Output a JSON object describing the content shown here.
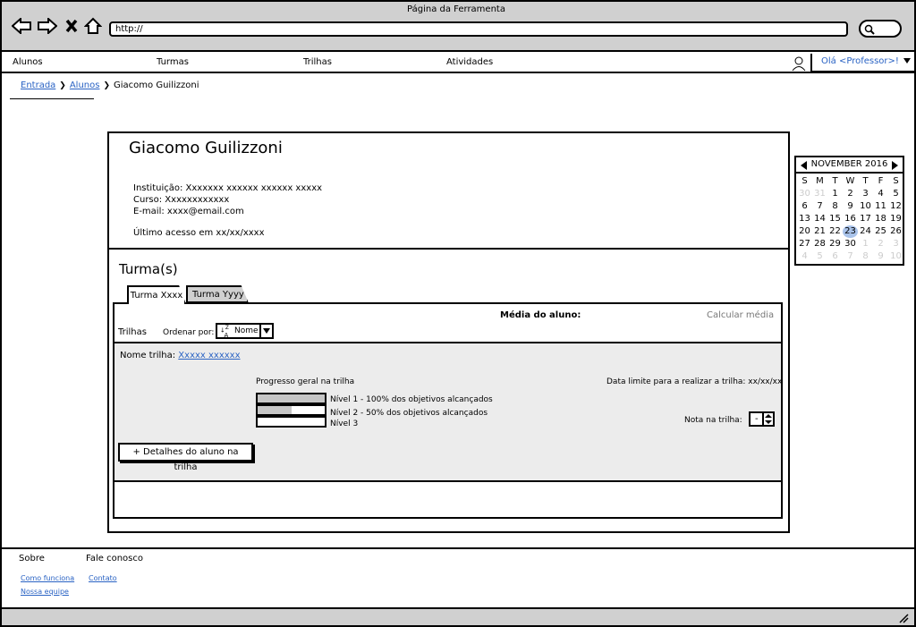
{
  "browser": {
    "title": "Página da Ferramenta",
    "url": "http://"
  },
  "menu": {
    "items": [
      "Alunos",
      "Turmas",
      "Trilhas",
      "Atividades"
    ],
    "user_label": "Olá <Professor>!"
  },
  "breadcrumb": {
    "items": [
      "Entrada",
      "Alunos"
    ],
    "current": "Giacomo Guilizzoni"
  },
  "profile": {
    "name": "Giacomo Guilizzoni",
    "instituicao": "Instituição: Xxxxxxx xxxxxx xxxxxx xxxxx",
    "curso": "Curso: Xxxxxxxxxxxx",
    "email": "E-mail: xxxx@email.com",
    "ultimo_acesso": "Último acesso em xx/xx/xxxx"
  },
  "turmas": {
    "heading": "Turma(s)",
    "tabs": [
      "Turma Xxxx",
      "Turma Yyyy"
    ],
    "active_tab": 0
  },
  "panel": {
    "media_label": "Média do aluno:",
    "calcular_label": "Calcular média",
    "trilhas_label": "Trilhas",
    "ordenar_label": "Ordenar por:",
    "sort_value": "Nome",
    "nome_trilha_label": "Nome trilha:",
    "nome_trilha_link": "Xxxxx xxxxxx",
    "progresso_label": "Progresso geral na trilha",
    "data_limite": "Data limite para a realizar a trilha: xx/xx/xx",
    "niveis": [
      {
        "label": "Nível 1 - 100% dos objetivos alcançados",
        "progress": 1.0
      },
      {
        "label": "Nível 2 - 50% dos objetivos alcançados",
        "progress": 0.5
      },
      {
        "label": "Nível 3",
        "progress": 0.0
      }
    ],
    "nota_label": "Nota na trilha:",
    "nota_value": "-",
    "detalhes_button": "+ Detalhes do aluno na trilha"
  },
  "calendar": {
    "month": "NOVEMBER 2016",
    "weekdays": [
      "S",
      "M",
      "T",
      "W",
      "T",
      "F",
      "S"
    ],
    "days": [
      [
        "30",
        "m"
      ],
      [
        "31",
        "m"
      ],
      [
        "1",
        ""
      ],
      [
        "2",
        ""
      ],
      [
        "3",
        ""
      ],
      [
        "4",
        ""
      ],
      [
        "5",
        ""
      ],
      [
        "6",
        ""
      ],
      [
        "7",
        ""
      ],
      [
        "8",
        ""
      ],
      [
        "9",
        ""
      ],
      [
        "10",
        ""
      ],
      [
        "11",
        ""
      ],
      [
        "12",
        ""
      ],
      [
        "13",
        ""
      ],
      [
        "14",
        ""
      ],
      [
        "15",
        ""
      ],
      [
        "16",
        ""
      ],
      [
        "17",
        ""
      ],
      [
        "18",
        ""
      ],
      [
        "19",
        ""
      ],
      [
        "20",
        ""
      ],
      [
        "21",
        ""
      ],
      [
        "22",
        ""
      ],
      [
        "23",
        "sel"
      ],
      [
        "24",
        ""
      ],
      [
        "25",
        ""
      ],
      [
        "26",
        ""
      ],
      [
        "27",
        ""
      ],
      [
        "28",
        ""
      ],
      [
        "29",
        ""
      ],
      [
        "30",
        ""
      ],
      [
        "1",
        "m"
      ],
      [
        "2",
        "m"
      ],
      [
        "3",
        "m"
      ],
      [
        "4",
        "m"
      ],
      [
        "5",
        "m"
      ],
      [
        "6",
        "m"
      ],
      [
        "7",
        "m"
      ],
      [
        "8",
        "m"
      ],
      [
        "9",
        "m"
      ],
      [
        "10",
        "m"
      ]
    ]
  },
  "footer": {
    "sobre": "Sobre",
    "fale": "Fale conosco",
    "links_sobre": [
      "Como funciona",
      "Nossa equipe"
    ],
    "links_fale": [
      "Contato"
    ]
  }
}
